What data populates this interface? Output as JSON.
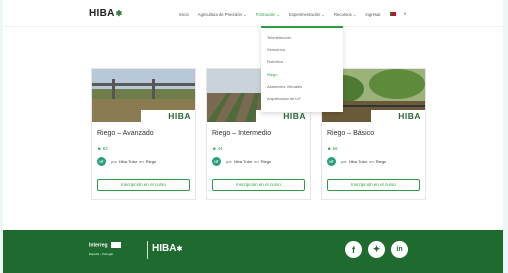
{
  "header": {
    "logo": "HIBA",
    "nav": [
      "Inicio",
      "Agricultura de Precisión ⌄",
      "Formación ⌄",
      "Experimentación ⌄",
      "Recursos ⌄",
      "Ingresar"
    ],
    "active_index": 2
  },
  "dropdown": {
    "items": [
      "Teledetección",
      "Sensórica",
      "Robótica",
      "Riego",
      "Asistentes Virtuales",
      "Arquitectura de IoT"
    ],
    "selected_index": 3
  },
  "courses": [
    {
      "title": "Riego – Avanzado",
      "students": "53",
      "initials": "HT",
      "by": "por",
      "author": "Hiba Tutor",
      "in": "en",
      "category": "Riego",
      "button": "Inscripción en el curso",
      "ribbon": "HIBA"
    },
    {
      "title": "Riego – Intermedio",
      "students": "44",
      "initials": "HT",
      "by": "por",
      "author": "Hiba Tutor",
      "in": "en",
      "category": "Riego",
      "button": "Inscripción en el curso",
      "ribbon": "HIBA"
    },
    {
      "title": "Riego – Básico",
      "students": "56",
      "initials": "HT",
      "by": "por",
      "author": "Hiba Tutor",
      "in": "en",
      "category": "Riego",
      "button": "Inscripción en el curso",
      "ribbon": "HIBA"
    }
  ],
  "footer": {
    "interreg": "Interreg",
    "interreg_sub": "España - Portugal",
    "logo": "HIBA",
    "social": [
      "f",
      "t",
      "in"
    ]
  },
  "colors": {
    "accent": "#2d9b47",
    "footer": "#1f6b2f"
  }
}
